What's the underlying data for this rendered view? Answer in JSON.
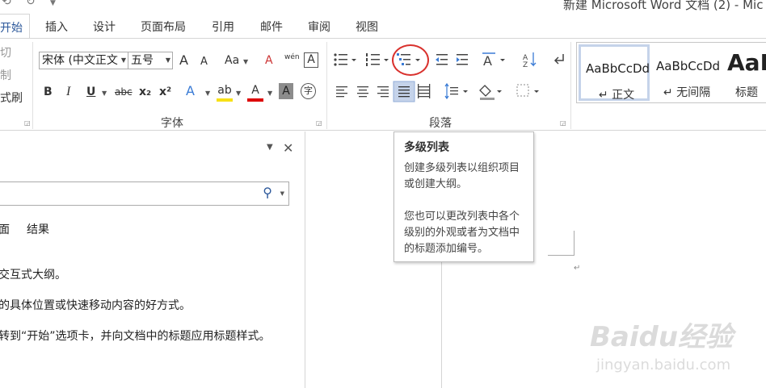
{
  "window": {
    "title": "新建 Microsoft Word 文档 (2) - Mic"
  },
  "tabs": [
    "开始",
    "插入",
    "设计",
    "页面布局",
    "引用",
    "邮件",
    "审阅",
    "视图"
  ],
  "ribbon": {
    "clipboard": {
      "cut": "切",
      "copy": "制",
      "format_painter": "式刷"
    },
    "font": {
      "group_label": "字体",
      "font_name": "宋体 (中文正文",
      "font_size": "五号",
      "grow": "A",
      "shrink": "A",
      "change_case": "Aa",
      "clear_format": "A",
      "phonetic": "wén",
      "char_border": "A",
      "bold": "B",
      "italic": "I",
      "underline": "U",
      "strike": "abc",
      "subscript": "x₂",
      "superscript": "x²",
      "text_effect": "A",
      "highlight": "ab",
      "font_color": "A",
      "char_shading": "A",
      "enclose": "字"
    },
    "paragraph": {
      "group_label": "段落"
    },
    "styles": {
      "items": [
        {
          "sample": "AaBbCcDd",
          "name": "正文"
        },
        {
          "sample": "AaBbCcDd",
          "name": "无间隔"
        },
        {
          "sample": "AaB",
          "name": "标题"
        }
      ]
    }
  },
  "tooltip": {
    "title": "多级列表",
    "desc1": "创建多级列表以组织项目或创建大纲。",
    "desc2": "您也可以更改列表中各个级别的外观或者为文档中的标题添加编号。"
  },
  "nav_pane": {
    "tabs": [
      "面",
      "结果"
    ],
    "lines": [
      "交互式大纲。",
      "的具体位置或快速移动内容的好方式。",
      "转到“开始”选项卡，并向文档中的标题应用标题样式。"
    ]
  },
  "watermark": {
    "brand": "Baidu经验",
    "url": "jingyan.baidu.com"
  }
}
